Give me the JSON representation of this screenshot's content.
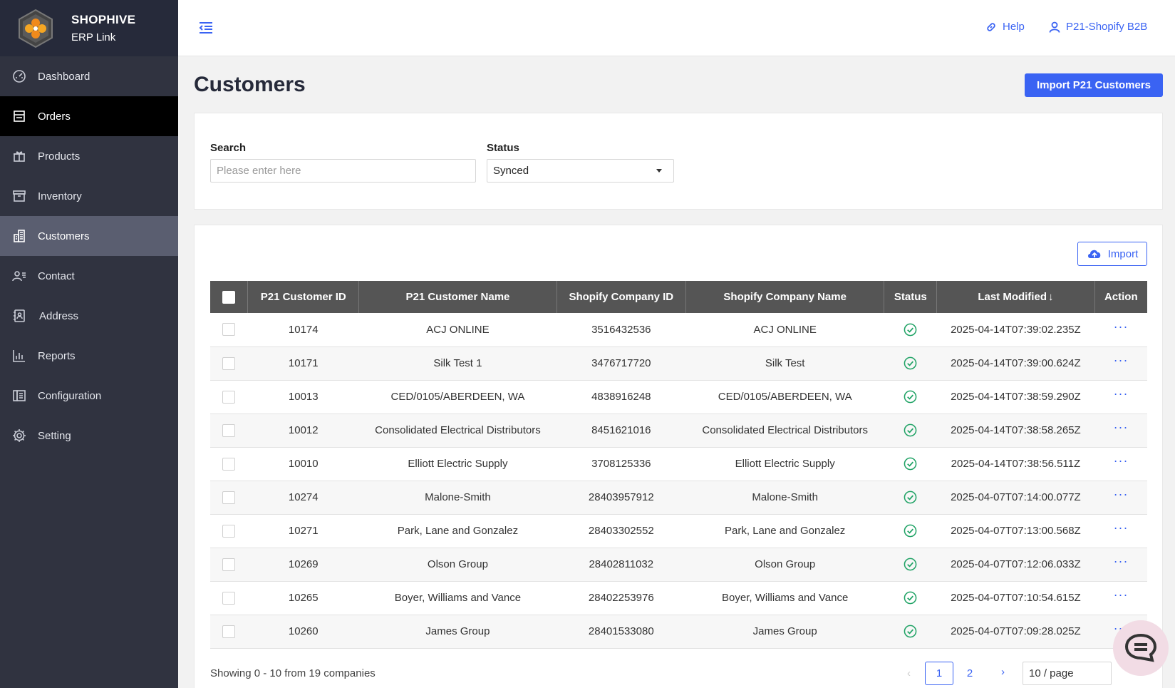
{
  "brand": {
    "name": "SHOPHIVE",
    "subtitle": "ERP Link"
  },
  "sidebar": {
    "items": [
      {
        "label": "Dashboard",
        "icon": "dashboard-icon"
      },
      {
        "label": "Orders",
        "icon": "orders-icon",
        "state": "active"
      },
      {
        "label": "Products",
        "icon": "gift-icon"
      },
      {
        "label": "Inventory",
        "icon": "archive-icon"
      },
      {
        "label": "Customers",
        "icon": "building-icon",
        "state": "selected"
      },
      {
        "label": "Contact",
        "icon": "contact-icon"
      },
      {
        "label": "Address",
        "icon": "address-book-icon"
      },
      {
        "label": "Reports",
        "icon": "bar-chart-icon"
      },
      {
        "label": "Configuration",
        "icon": "configuration-icon"
      },
      {
        "label": "Setting",
        "icon": "gear-icon"
      }
    ]
  },
  "topbar": {
    "help_label": "Help",
    "user_label": "P21-Shopify B2B"
  },
  "page": {
    "title": "Customers",
    "import_p21_label": "Import P21 Customers"
  },
  "filters": {
    "search_label": "Search",
    "search_placeholder": "Please enter here",
    "search_value": "",
    "status_label": "Status",
    "status_value": "Synced"
  },
  "table": {
    "import_label": "Import",
    "headers": {
      "p21_id": "P21 Customer ID",
      "p21_name": "P21 Customer Name",
      "shopify_id": "Shopify Company ID",
      "shopify_name": "Shopify Company Name",
      "status": "Status",
      "last_modified": "Last Modified",
      "action": "Action"
    },
    "rows": [
      {
        "p21_id": "10174",
        "p21_name": "ACJ ONLINE",
        "shopify_id": "3516432536",
        "shopify_name": "ACJ ONLINE",
        "status": "synced",
        "last_modified": "2025-04-14T07:39:02.235Z",
        "action": "···"
      },
      {
        "p21_id": "10171",
        "p21_name": "Silk Test 1",
        "shopify_id": "3476717720",
        "shopify_name": "Silk Test",
        "status": "synced",
        "last_modified": "2025-04-14T07:39:00.624Z",
        "action": "···"
      },
      {
        "p21_id": "10013",
        "p21_name": "CED/0105/ABERDEEN, WA",
        "shopify_id": "4838916248",
        "shopify_name": "CED/0105/ABERDEEN, WA",
        "status": "synced",
        "last_modified": "2025-04-14T07:38:59.290Z",
        "action": "···"
      },
      {
        "p21_id": "10012",
        "p21_name": "Consolidated Electrical Distributors",
        "shopify_id": "8451621016",
        "shopify_name": "Consolidated Electrical Distributors",
        "status": "synced",
        "last_modified": "2025-04-14T07:38:58.265Z",
        "action": "···"
      },
      {
        "p21_id": "10010",
        "p21_name": "Elliott Electric Supply",
        "shopify_id": "3708125336",
        "shopify_name": "Elliott Electric Supply",
        "status": "synced",
        "last_modified": "2025-04-14T07:38:56.511Z",
        "action": "···"
      },
      {
        "p21_id": "10274",
        "p21_name": "Malone-Smith",
        "shopify_id": "28403957912",
        "shopify_name": "Malone-Smith",
        "status": "synced",
        "last_modified": "2025-04-07T07:14:00.077Z",
        "action": "···"
      },
      {
        "p21_id": "10271",
        "p21_name": "Park, Lane and Gonzalez",
        "shopify_id": "28403302552",
        "shopify_name": "Park, Lane and Gonzalez",
        "status": "synced",
        "last_modified": "2025-04-07T07:13:00.568Z",
        "action": "···"
      },
      {
        "p21_id": "10269",
        "p21_name": "Olson Group",
        "shopify_id": "28402811032",
        "shopify_name": "Olson Group",
        "status": "synced",
        "last_modified": "2025-04-07T07:12:06.033Z",
        "action": "···"
      },
      {
        "p21_id": "10265",
        "p21_name": "Boyer, Williams and Vance",
        "shopify_id": "28402253976",
        "shopify_name": "Boyer, Williams and Vance",
        "status": "synced",
        "last_modified": "2025-04-07T07:10:54.615Z",
        "action": "···"
      },
      {
        "p21_id": "10260",
        "p21_name": "James Group",
        "shopify_id": "28401533080",
        "shopify_name": "James Group",
        "status": "synced",
        "last_modified": "2025-04-07T07:09:28.025Z",
        "action": "···"
      }
    ]
  },
  "pagination": {
    "summary": "Showing 0 - 10 from 19 companies",
    "prev": "‹",
    "pages": [
      "1",
      "2"
    ],
    "current_page": "1",
    "next": "›",
    "page_size": "10 / page"
  },
  "colors": {
    "accent": "#3a63f3",
    "sidebar": "#303340",
    "status_ok": "#21a366",
    "header": "#555555"
  }
}
